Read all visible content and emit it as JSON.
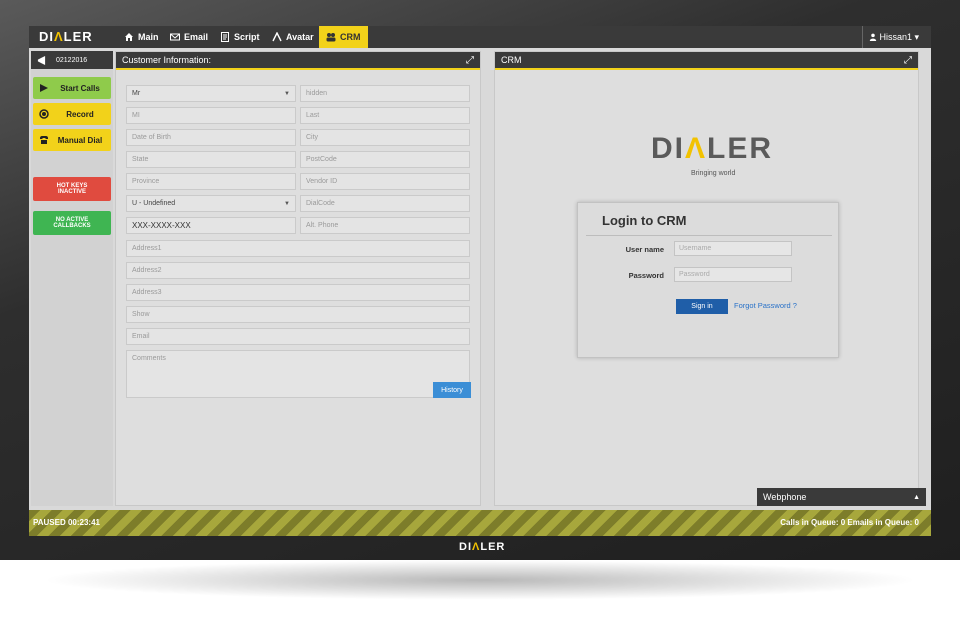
{
  "app": {
    "logo_pre": "DI",
    "logo_mark": "Λ",
    "logo_post": "LER"
  },
  "tabs": [
    {
      "label": "Main"
    },
    {
      "label": "Email"
    },
    {
      "label": "Script"
    },
    {
      "label": "Avatar"
    },
    {
      "label": "CRM"
    }
  ],
  "user": {
    "name": "Hissan1 ▾"
  },
  "left": {
    "date": "02122016",
    "start_calls": "Start Calls",
    "record": "Record",
    "manual_dial": "Manual Dial",
    "hot_keys": "HOT KEYS INACTIVE",
    "callbacks": "NO ACTIVE CALLBACKS",
    "colors": {
      "green": "#8fcb4b",
      "yellow": "#f2d21a",
      "red": "#e04b3f",
      "green2": "#3fb552"
    }
  },
  "customer": {
    "title": "Customer Information:",
    "fields": {
      "salutation": "Mr",
      "hidden": "hidden",
      "mi": "MI",
      "last": "Last",
      "dob": "Date of Birth",
      "city": "City",
      "state": "State",
      "postcode": "PostCode",
      "province": "Province",
      "vendor": "Vendor ID",
      "gender": "U - Undefined",
      "dialcode": "DialCode",
      "phone": "XXX-XXXX-XXX",
      "alt_phone": "Alt. Phone",
      "address1": "Address1",
      "address2": "Address2",
      "address3": "Address3",
      "show": "Show",
      "email": "Email",
      "comments": "Comments"
    },
    "history": "History"
  },
  "crm": {
    "title": "CRM",
    "tagline": "Bringing world",
    "login_title": "Login to CRM",
    "username_label": "User name",
    "username_placeholder": "Username",
    "password_label": "Password",
    "password_placeholder": "Password",
    "sign_in": "Sign in",
    "forgot": "Forgot Password ?"
  },
  "webphone": {
    "label": "Webphone"
  },
  "status": {
    "left": "PAUSED  00:23:41",
    "right": "Calls in Queue: 0  Emails in Queue: 0"
  }
}
